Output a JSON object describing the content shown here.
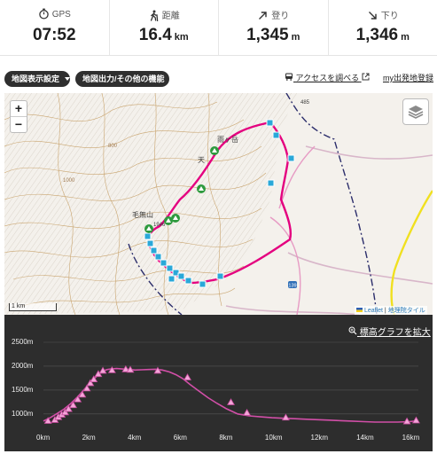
{
  "stats": [
    {
      "label": "GPS",
      "value": "07:52",
      "unit": "",
      "icon": "stopwatch-icon"
    },
    {
      "label": "距離",
      "value": "16.4",
      "unit": "km",
      "icon": "hiker-icon"
    },
    {
      "label": "登り",
      "value": "1,345",
      "unit": "m",
      "icon": "arrow-up-right-icon"
    },
    {
      "label": "下り",
      "value": "1,346",
      "unit": "m",
      "icon": "arrow-down-right-icon"
    }
  ],
  "toolbar": {
    "map_display_settings": "地図表示設定",
    "map_output_other": "地図出力/その他の機能",
    "access_link": "アクセスを調べる",
    "my_trailhead_link": "my出発地登録"
  },
  "map": {
    "zoom_in": "+",
    "zoom_out": "−",
    "scale_label": "1 km",
    "attribution_leaflet": "Leaflet",
    "attribution_sep": " | ",
    "attribution_gsi": "地理院タイル",
    "labels": {
      "peak_a": "雨ヶ岳",
      "peak_b": "天",
      "peak_c": "毛無山",
      "elev_1946": "1946",
      "road_485": "485",
      "road_139": "139",
      "elev_800": "800",
      "elev_1000": "1000"
    },
    "colors": {
      "route": "#e4007f",
      "waypoint": "#2aa8d8",
      "summit": "#2e9a3e",
      "contour": "#c8a06a"
    }
  },
  "elevation": {
    "expand_label": "標高グラフを拡大"
  },
  "chart_data": {
    "type": "line",
    "title": "",
    "xlabel": "",
    "ylabel": "",
    "xlim": [
      0,
      16.4
    ],
    "ylim": [
      700,
      2500
    ],
    "x_ticks": [
      "0km",
      "2km",
      "4km",
      "6km",
      "8km",
      "10km",
      "12km",
      "14km",
      "16km"
    ],
    "y_ticks": [
      "1000m",
      "1500m",
      "2000m",
      "2500m"
    ],
    "line_color": "#d24fa8",
    "series": [
      {
        "x": [
          0,
          0.3,
          0.6,
          0.9,
          1.2,
          1.5,
          1.8,
          2.1,
          2.4,
          2.6,
          2.8,
          3.0,
          3.2,
          3.5,
          3.8,
          4.0,
          4.3,
          4.6,
          4.9,
          5.2,
          5.5,
          5.8,
          6.1,
          6.4,
          6.8,
          7.2,
          7.6,
          8.0,
          8.5,
          9.0,
          9.5,
          10.0,
          10.5,
          11.0,
          11.5,
          12.0,
          12.5,
          13.0,
          13.5,
          14.0,
          14.5,
          15.0,
          15.5,
          16.0,
          16.4
        ],
        "y": [
          850,
          920,
          1010,
          1100,
          1220,
          1360,
          1520,
          1680,
          1820,
          1900,
          1930,
          1945,
          1950,
          1940,
          1930,
          1920,
          1925,
          1930,
          1935,
          1920,
          1880,
          1820,
          1740,
          1620,
          1480,
          1340,
          1220,
          1110,
          1000,
          960,
          940,
          920,
          910,
          900,
          890,
          880,
          870,
          860,
          850,
          840,
          830,
          830,
          830,
          840,
          860
        ]
      }
    ],
    "markers": {
      "x": [
        0.2,
        0.5,
        0.65,
        0.8,
        0.95,
        1.1,
        1.3,
        1.5,
        1.7,
        1.9,
        2.05,
        2.2,
        2.4,
        2.6,
        3.0,
        3.6,
        3.8,
        5.0,
        6.3,
        8.2,
        8.9,
        10.6,
        15.9,
        16.3
      ],
      "y": [
        850,
        870,
        930,
        980,
        1030,
        1100,
        1180,
        1300,
        1400,
        1530,
        1640,
        1720,
        1830,
        1900,
        1910,
        1930,
        1920,
        1900,
        1760,
        1240,
        1020,
        920,
        840,
        860
      ]
    }
  }
}
